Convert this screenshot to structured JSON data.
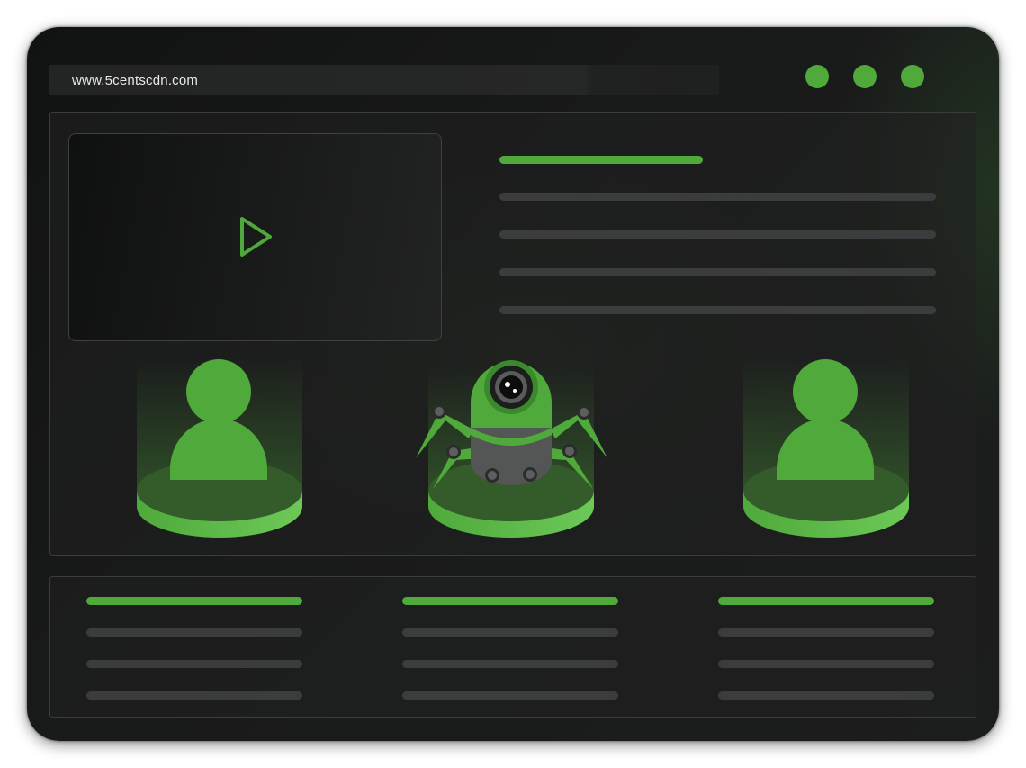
{
  "browser": {
    "url": "www.5centscdn.com",
    "window_controls": [
      "control-dot-1",
      "control-dot-2",
      "control-dot-3"
    ],
    "control_color": "#4fa93b"
  },
  "hero": {
    "video": {
      "icon": "play-icon"
    },
    "figures": [
      {
        "icon": "user-icon"
      },
      {
        "icon": "robot-camera-icon"
      },
      {
        "icon": "user-icon"
      }
    ]
  },
  "colors": {
    "accent": "#4fa93b",
    "accent_light": "#6cc957",
    "text_line": "#3b3c3d",
    "background": "#1a1b1b",
    "border": "#3b3c3c"
  }
}
